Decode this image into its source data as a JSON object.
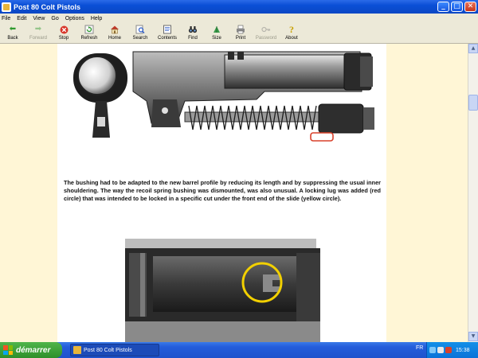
{
  "window": {
    "title": "Post 80 Colt Pistols"
  },
  "menu": [
    "File",
    "Edit",
    "View",
    "Go",
    "Options",
    "Help"
  ],
  "toolbar": [
    {
      "label": "Back",
      "icon": "back-arrow-icon",
      "enabled": true
    },
    {
      "label": "Forward",
      "icon": "forward-arrow-icon",
      "enabled": false
    },
    {
      "label": "Stop",
      "icon": "stop-icon",
      "enabled": true
    },
    {
      "label": "Refresh",
      "icon": "refresh-icon",
      "enabled": true
    },
    {
      "label": "Home",
      "icon": "home-icon",
      "enabled": true
    },
    {
      "label": "Search",
      "icon": "search-icon",
      "enabled": true
    },
    {
      "label": "Contents",
      "icon": "contents-icon",
      "enabled": true
    },
    {
      "label": "Find",
      "icon": "binoculars-icon",
      "enabled": true
    },
    {
      "label": "Size",
      "icon": "size-icon",
      "enabled": true
    },
    {
      "label": "Print",
      "icon": "printer-icon",
      "enabled": true
    },
    {
      "label": "Password",
      "icon": "key-icon",
      "enabled": false
    },
    {
      "label": "About",
      "icon": "help-icon",
      "enabled": true
    }
  ],
  "content": {
    "paragraph": "The bushing had to be adapted to the new barrel profile by reducing its length and by suppressing the usual inner shouldering. The way the recoil spring bushing was dismounted, was also unusual. A locking lug was added (red circle) that was intended to be locked in a specific cut under the front end of the slide (yellow circle)."
  },
  "taskbar": {
    "start_label": "démarrer",
    "task_title": "Post 80 Colt Pistols",
    "language": "FR",
    "clock": "15:38"
  },
  "colors": {
    "titlebar": "#0A4FD6",
    "page_background": "#FFF6D6",
    "highlight_red": "#D8402A",
    "highlight_yellow": "#F2D000"
  }
}
